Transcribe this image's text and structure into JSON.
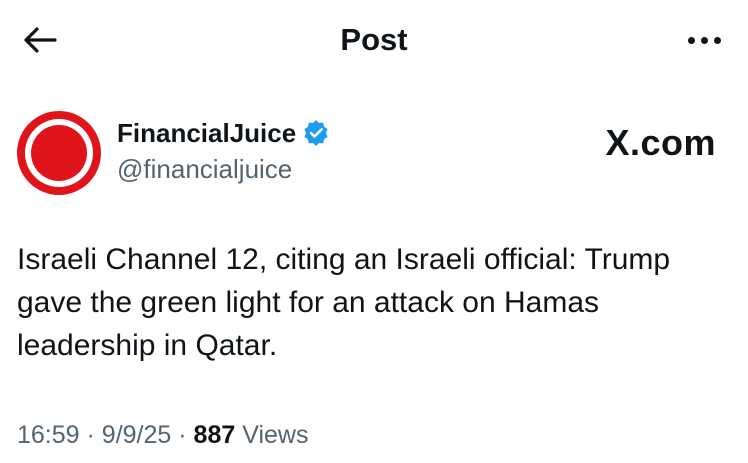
{
  "header": {
    "title": "Post",
    "back_icon": "arrow-left-icon",
    "more_icon": "more-horizontal-icon"
  },
  "author": {
    "name": "FinancialJuice",
    "handle": "@financialjuice",
    "verified": true,
    "verified_color": "#1d9bf0",
    "avatar_color": "#e0141b"
  },
  "watermark": "X.com",
  "post": {
    "text": "Israeli Channel 12, citing an Israeli official: Trump gave the green light for an attack on Hamas leadership in Qatar."
  },
  "meta": {
    "time": "16:59",
    "separator": "·",
    "date": "9/9/25",
    "views_count": "887",
    "views_label": "Views"
  }
}
